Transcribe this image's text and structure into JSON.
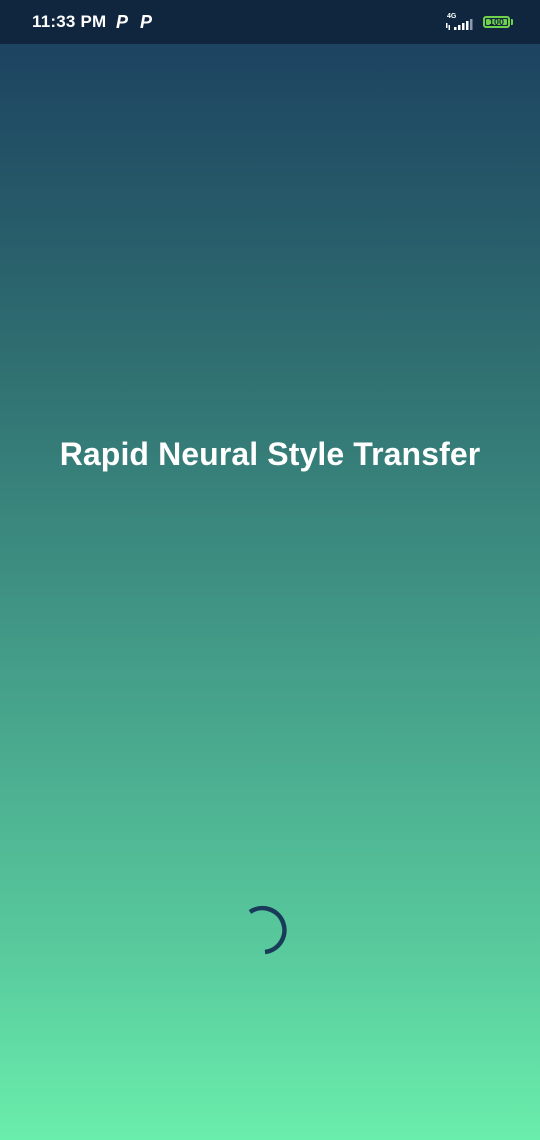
{
  "status_bar": {
    "time": "11:33 PM",
    "notifications": [
      "P",
      "P"
    ],
    "network": "4G",
    "battery_level": "100",
    "battery_color": "#6fd24a"
  },
  "splash": {
    "title": "Rapid Neural Style Transfer",
    "background_top": "#1a3d5e",
    "background_bottom": "#6aeeac",
    "spinner_color": "#1a3a5a"
  }
}
